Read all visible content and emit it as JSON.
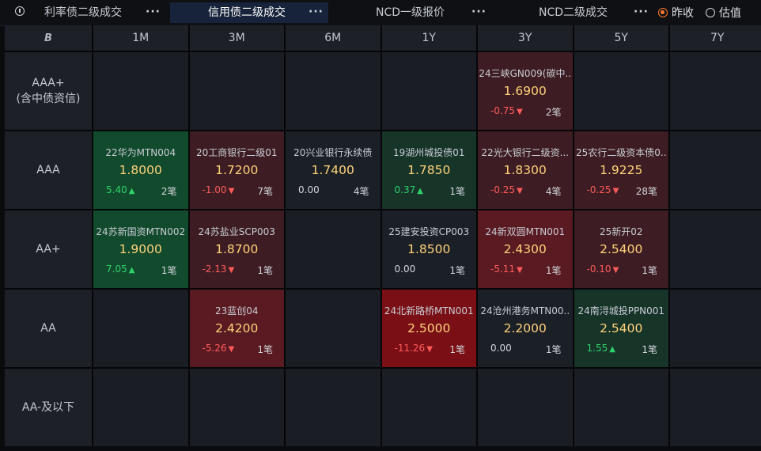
{
  "tabs": [
    {
      "label": "利率债二级成交",
      "active": false
    },
    {
      "label": "信用债二级成交",
      "active": true
    },
    {
      "label": "NCD一级报价",
      "active": false
    },
    {
      "label": "NCD二级成交",
      "active": false
    }
  ],
  "more_label": "···",
  "radio": {
    "option1": "昨收",
    "option2": "估值",
    "selected": "昨收"
  },
  "colors": {
    "up": "#2fd36b",
    "down": "#ff5a5a",
    "price": "#ffd27a",
    "accent": "#ff7a2e"
  },
  "grid": {
    "corner_icon": "B",
    "columns": [
      "1M",
      "3M",
      "6M",
      "1Y",
      "3Y",
      "5Y",
      "7Y"
    ],
    "rows": [
      {
        "label": "AAA+",
        "sub": "(含中债资信)"
      },
      {
        "label": "AAA",
        "sub": ""
      },
      {
        "label": "AA+",
        "sub": ""
      },
      {
        "label": "AA",
        "sub": ""
      },
      {
        "label": "AA-及以下",
        "sub": ""
      }
    ]
  },
  "cells": [
    {
      "row": 0,
      "col": 4,
      "tone": "t-red3",
      "name": "24三峡GN009(碳中..",
      "price": "1.6900",
      "change": "-0.75",
      "dir": "dn",
      "count": "2笔"
    },
    {
      "row": 1,
      "col": 0,
      "tone": "t-green",
      "name": "22华为MTN004",
      "price": "1.8000",
      "change": "5.40",
      "dir": "up",
      "count": "2笔"
    },
    {
      "row": 1,
      "col": 1,
      "tone": "t-red3",
      "name": "20工商银行二级01",
      "price": "1.7200",
      "change": "-1.00",
      "dir": "dn",
      "count": "7笔"
    },
    {
      "row": 1,
      "col": 2,
      "tone": "t-gray",
      "name": "20兴业银行永续债",
      "price": "1.7400",
      "change": "0.00",
      "dir": "flat",
      "count": "4笔"
    },
    {
      "row": 1,
      "col": 3,
      "tone": "t-green2",
      "name": "19湖州城投债01",
      "price": "1.7850",
      "change": "0.37",
      "dir": "up",
      "count": "1笔"
    },
    {
      "row": 1,
      "col": 4,
      "tone": "t-red3",
      "name": "22光大银行二级资...",
      "price": "1.8300",
      "change": "-0.25",
      "dir": "dn",
      "count": "4笔"
    },
    {
      "row": 1,
      "col": 5,
      "tone": "t-red3",
      "name": "25农行二级资本债0..",
      "price": "1.9225",
      "change": "-0.25",
      "dir": "dn",
      "count": "28笔"
    },
    {
      "row": 2,
      "col": 0,
      "tone": "t-green",
      "name": "24苏新国资MTN002",
      "price": "1.9000",
      "change": "7.05",
      "dir": "up",
      "count": "1笔"
    },
    {
      "row": 2,
      "col": 1,
      "tone": "t-red3",
      "name": "24苏盐业SCP003",
      "price": "1.8700",
      "change": "-2.13",
      "dir": "dn",
      "count": "1笔"
    },
    {
      "row": 2,
      "col": 3,
      "tone": "t-gray",
      "name": "25建安投资CP003",
      "price": "1.8500",
      "change": "0.00",
      "dir": "flat",
      "count": "1笔"
    },
    {
      "row": 2,
      "col": 4,
      "tone": "t-red2",
      "name": "24新双圆MTN001",
      "price": "2.4300",
      "change": "-5.11",
      "dir": "dn",
      "count": "1笔"
    },
    {
      "row": 2,
      "col": 5,
      "tone": "t-red3",
      "name": "25新开02",
      "price": "2.5400",
      "change": "-0.10",
      "dir": "dn",
      "count": "1笔"
    },
    {
      "row": 3,
      "col": 1,
      "tone": "t-red2",
      "name": "23蓝创04",
      "price": "2.4200",
      "change": "-5.26",
      "dir": "dn",
      "count": "1笔"
    },
    {
      "row": 3,
      "col": 3,
      "tone": "t-red",
      "name": "24北新路桥MTN001",
      "price": "2.5000",
      "change": "-11.26",
      "dir": "dn",
      "count": "1笔"
    },
    {
      "row": 3,
      "col": 4,
      "tone": "t-gray",
      "name": "24沧州港务MTN00..",
      "price": "2.2000",
      "change": "0.00",
      "dir": "flat",
      "count": "1笔"
    },
    {
      "row": 3,
      "col": 5,
      "tone": "t-green2",
      "name": "24南浔城投PPN001",
      "price": "2.5400",
      "change": "1.55",
      "dir": "up",
      "count": "1笔"
    }
  ]
}
